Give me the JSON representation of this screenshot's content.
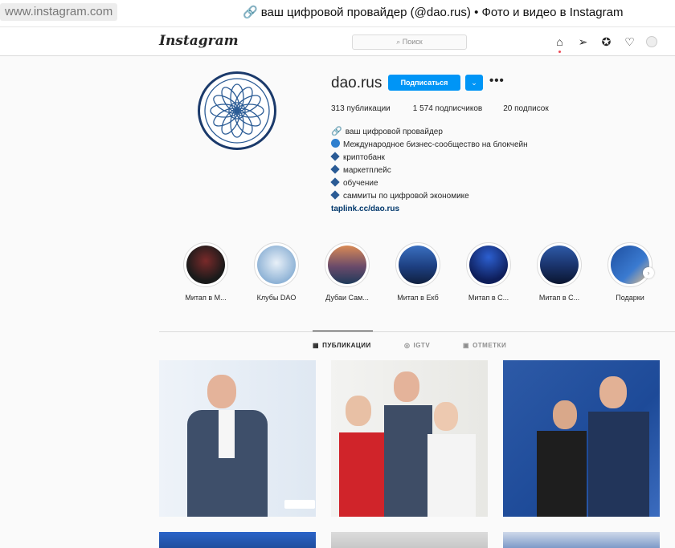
{
  "browser": {
    "url": "www.instagram.com",
    "window_title": "ваш цифровой провайдер (@dao.rus) • Фото и видео в Instagram"
  },
  "nav": {
    "logo": "Instagram",
    "search_placeholder": "Поиск"
  },
  "profile": {
    "username": "dao.rus",
    "follow_label": "Подписаться",
    "dropdown_glyph": "⌄",
    "more_glyph": "•••",
    "stats": {
      "posts": "313 публикации",
      "followers": "1 574 подписчиков",
      "following": "20 подписок"
    },
    "bio": {
      "line1": "ваш цифровой провайдер",
      "line2": "Международное бизнес-сообщество на блокчейн",
      "line3": "криптобанк",
      "line4": "маркетплейс",
      "line5": "обучение",
      "line6": "саммиты по цифровой экономике",
      "link": "taplink.cc/dao.rus"
    }
  },
  "highlights": [
    {
      "label": "Митап в М..."
    },
    {
      "label": "Клубы DAO"
    },
    {
      "label": "Дубаи Сам..."
    },
    {
      "label": "Митап в Екб"
    },
    {
      "label": "Митап в С..."
    },
    {
      "label": "Митап в С..."
    },
    {
      "label": "Подарки"
    }
  ],
  "tabs": [
    {
      "label": "ПУБЛИКАЦИИ",
      "icon": "grid-icon",
      "active": true
    },
    {
      "label": "IGTV",
      "icon": "igtv-icon",
      "active": false
    },
    {
      "label": "ОТМЕТКИ",
      "icon": "tag-icon",
      "active": false
    }
  ],
  "colors": {
    "accent": "#0095f6",
    "brand_dark_blue": "#1b3a6b"
  }
}
